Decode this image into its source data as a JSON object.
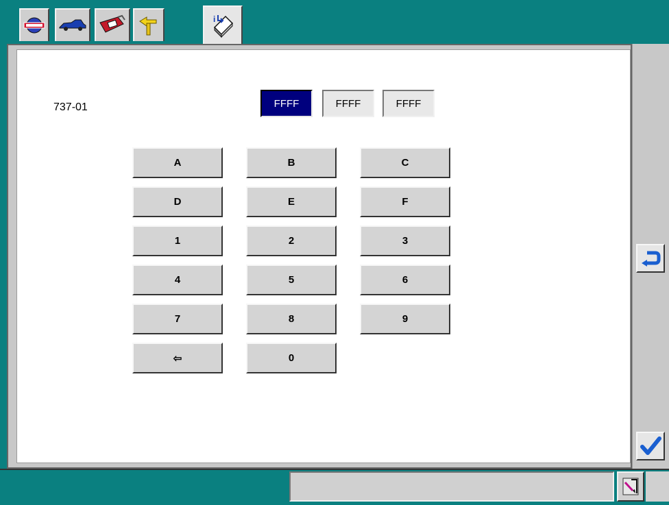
{
  "header": {
    "tabs": [
      {
        "icon": "nissan-logo-icon"
      },
      {
        "icon": "car-icon"
      },
      {
        "icon": "toolbox-icon"
      },
      {
        "icon": "direction-arrow-icon"
      }
    ],
    "active_tab": {
      "icon": "info-book-icon"
    }
  },
  "main": {
    "id_label": "737-01",
    "hex_fields": [
      {
        "value": "FFFF",
        "selected": true
      },
      {
        "value": "FFFF",
        "selected": false
      },
      {
        "value": "FFFF",
        "selected": false
      }
    ],
    "keys": [
      "A",
      "B",
      "C",
      "D",
      "E",
      "F",
      "1",
      "2",
      "3",
      "4",
      "5",
      "6",
      "7",
      "8",
      "9",
      "⇦",
      "0"
    ]
  },
  "sidebar": {
    "back_icon": "return-arrow-icon",
    "confirm_icon": "checkmark-icon"
  },
  "statusbar": {
    "text": "",
    "icon": "pen-icon"
  },
  "colors": {
    "background": "#0a8080",
    "selected_field": "#00007e",
    "confirm": "#1a5fd0"
  }
}
